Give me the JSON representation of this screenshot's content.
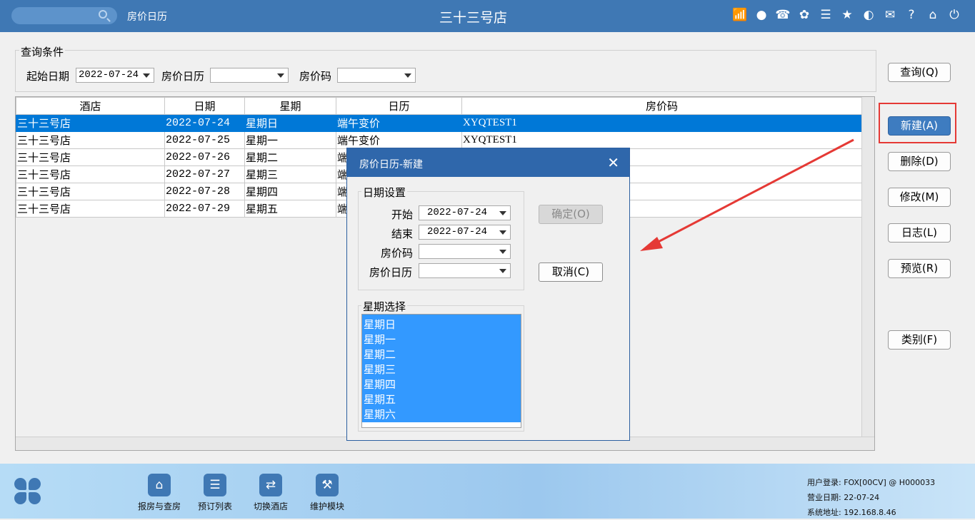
{
  "topbar": {
    "module": "房价日历",
    "title": "三十三号店",
    "icons": [
      "wifi-icon",
      "chat-icon",
      "phone-icon",
      "palette-icon",
      "menu-icon",
      "star-icon",
      "theme-icon",
      "mail-icon",
      "help-icon",
      "home-icon",
      "power-icon"
    ]
  },
  "query": {
    "legend": "查询条件",
    "start_date_label": "起始日期",
    "start_date_value": "2022-07-24",
    "calendar_label": "房价日历",
    "calendar_value": "",
    "rate_code_label": "房价码",
    "rate_code_value": ""
  },
  "grid": {
    "columns": [
      "酒店",
      "日期",
      "星期",
      "日历",
      "房价码"
    ],
    "rows": [
      {
        "hotel": "三十三号店",
        "date": "2022-07-24",
        "weekday": "星期日",
        "calendar": "端午变价",
        "rate_code": "XYQTEST1"
      },
      {
        "hotel": "三十三号店",
        "date": "2022-07-25",
        "weekday": "星期一",
        "calendar": "端午变价",
        "rate_code": "XYQTEST1"
      },
      {
        "hotel": "三十三号店",
        "date": "2022-07-26",
        "weekday": "星期二",
        "calendar": "端",
        "rate_code": ""
      },
      {
        "hotel": "三十三号店",
        "date": "2022-07-27",
        "weekday": "星期三",
        "calendar": "端",
        "rate_code": ""
      },
      {
        "hotel": "三十三号店",
        "date": "2022-07-28",
        "weekday": "星期四",
        "calendar": "端",
        "rate_code": ""
      },
      {
        "hotel": "三十三号店",
        "date": "2022-07-29",
        "weekday": "星期五",
        "calendar": "端",
        "rate_code": ""
      }
    ]
  },
  "buttons": {
    "query": "查询(Q)",
    "new": "新建(A)",
    "delete": "删除(D)",
    "modify": "修改(M)",
    "log": "日志(L)",
    "preview": "预览(R)",
    "category": "类别(F)"
  },
  "dialog": {
    "title": "房价日历-新建",
    "date_group": "日期设置",
    "start_label": "开始",
    "start_value": "2022-07-24",
    "end_label": "结束",
    "end_value": "2022-07-24",
    "rate_code_label": "房价码",
    "rate_code_value": "",
    "calendar_label": "房价日历",
    "calendar_value": "",
    "ok_button": "确定(O)",
    "cancel_button": "取消(C)",
    "weekday_group": "星期选择",
    "weekdays": [
      "星期日",
      "星期一",
      "星期二",
      "星期三",
      "星期四",
      "星期五",
      "星期六"
    ]
  },
  "bottombar": {
    "items": [
      {
        "label": "报房与查房",
        "icon": "home-search-icon"
      },
      {
        "label": "预订列表",
        "icon": "booking-list-icon"
      },
      {
        "label": "切换酒店",
        "icon": "switch-icon"
      },
      {
        "label": "维护模块",
        "icon": "wrench-icon"
      }
    ],
    "status": {
      "user": "用户登录:  FOX[00CV] @ H000033",
      "business_date": "营业日期:  22-07-24",
      "system_address": "系统地址:  192.168.8.46"
    }
  },
  "colors": {
    "header": "#3f78b4",
    "selection": "#0078d7",
    "list_selection": "#3399ff",
    "annotation": "#e53935"
  }
}
